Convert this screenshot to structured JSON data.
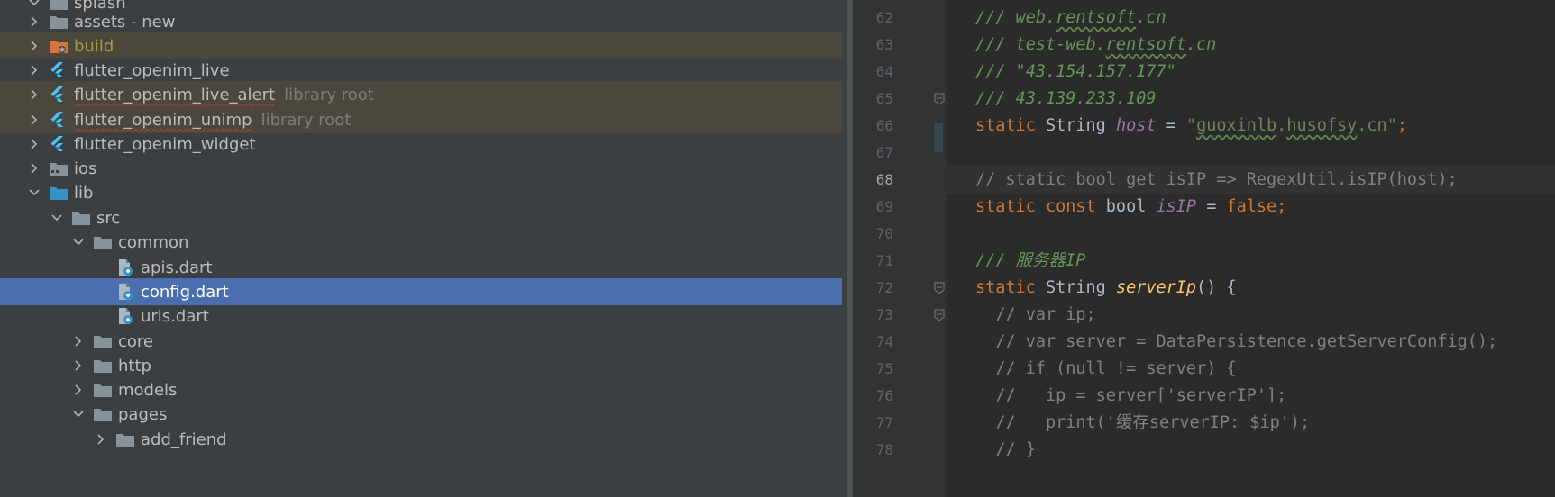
{
  "tree": {
    "items": [
      {
        "label": "splash",
        "suffix": "",
        "indent": 1,
        "expanded": true,
        "icon": "folder",
        "state": "normal"
      },
      {
        "label": "assets - new",
        "suffix": "",
        "indent": 1,
        "expanded": false,
        "icon": "folder",
        "state": "normal"
      },
      {
        "label": "build",
        "suffix": "",
        "indent": 1,
        "expanded": false,
        "icon": "folder-excluded",
        "state": "excluded"
      },
      {
        "label": "flutter_openim_live",
        "suffix": "",
        "indent": 1,
        "expanded": false,
        "icon": "flutter",
        "state": "normal"
      },
      {
        "label": "flutter_openim_live_alert",
        "suffix": "library root",
        "indent": 1,
        "expanded": false,
        "icon": "flutter",
        "state": "library"
      },
      {
        "label": "flutter_openim_unimp",
        "suffix": "library root",
        "indent": 1,
        "expanded": false,
        "icon": "flutter",
        "state": "library"
      },
      {
        "label": "flutter_openim_widget",
        "suffix": "",
        "indent": 1,
        "expanded": false,
        "icon": "flutter",
        "state": "normal"
      },
      {
        "label": "ios",
        "suffix": "",
        "indent": 1,
        "expanded": false,
        "icon": "folder-ios",
        "state": "normal"
      },
      {
        "label": "lib",
        "suffix": "",
        "indent": 1,
        "expanded": true,
        "icon": "folder-blue",
        "state": "normal"
      },
      {
        "label": "src",
        "suffix": "",
        "indent": 2,
        "expanded": true,
        "icon": "folder",
        "state": "normal"
      },
      {
        "label": "common",
        "suffix": "",
        "indent": 3,
        "expanded": true,
        "icon": "folder",
        "state": "normal"
      },
      {
        "label": "apis.dart",
        "suffix": "",
        "indent": 4,
        "expanded": null,
        "icon": "dart-file",
        "state": "normal"
      },
      {
        "label": "config.dart",
        "suffix": "",
        "indent": 4,
        "expanded": null,
        "icon": "dart-file",
        "state": "selected"
      },
      {
        "label": "urls.dart",
        "suffix": "",
        "indent": 4,
        "expanded": null,
        "icon": "dart-file",
        "state": "normal"
      },
      {
        "label": "core",
        "suffix": "",
        "indent": 3,
        "expanded": false,
        "icon": "folder",
        "state": "normal"
      },
      {
        "label": "http",
        "suffix": "",
        "indent": 3,
        "expanded": false,
        "icon": "folder",
        "state": "normal"
      },
      {
        "label": "models",
        "suffix": "",
        "indent": 3,
        "expanded": false,
        "icon": "folder",
        "state": "normal"
      },
      {
        "label": "pages",
        "suffix": "",
        "indent": 3,
        "expanded": true,
        "icon": "folder",
        "state": "normal"
      },
      {
        "label": "add_friend",
        "suffix": "",
        "indent": 4,
        "expanded": false,
        "icon": "folder",
        "state": "normal"
      }
    ]
  },
  "editor": {
    "current_line": 68,
    "lines": [
      {
        "n": "62",
        "tokens": [
          [
            "t-doc",
            "/// web."
          ],
          [
            "t-doc-u",
            "rentsoft"
          ],
          [
            "t-doc",
            ".cn"
          ]
        ]
      },
      {
        "n": "63",
        "tokens": [
          [
            "t-doc",
            "/// test-web."
          ],
          [
            "t-doc-u",
            "rentsoft"
          ],
          [
            "t-doc",
            ".cn"
          ]
        ]
      },
      {
        "n": "64",
        "tokens": [
          [
            "t-doc",
            "/// \"43.154.157.177\""
          ]
        ]
      },
      {
        "n": "65",
        "tokens": [
          [
            "t-doc",
            "/// 43.139.233.109"
          ]
        ]
      },
      {
        "n": "66",
        "tokens": [
          [
            "t-kw",
            "static "
          ],
          [
            "t-type",
            "String "
          ],
          [
            "t-field",
            "host"
          ],
          [
            "t-plain",
            " = "
          ],
          [
            "t-str",
            "\""
          ],
          [
            "t-str-u",
            "guoxinlb"
          ],
          [
            "t-str",
            "."
          ],
          [
            "t-str-u",
            "husofsy"
          ],
          [
            "t-str",
            ".cn\""
          ],
          [
            "t-kw",
            ";"
          ]
        ]
      },
      {
        "n": "67",
        "tokens": []
      },
      {
        "n": "68",
        "tokens": [
          [
            "t-cmt",
            "// static bool get isIP => RegexUtil.isIP(host);"
          ]
        ]
      },
      {
        "n": "69",
        "tokens": [
          [
            "t-kw",
            "static const "
          ],
          [
            "t-type",
            "bool "
          ],
          [
            "t-field",
            "isIP"
          ],
          [
            "t-plain",
            " = "
          ],
          [
            "t-kw",
            "false;"
          ]
        ]
      },
      {
        "n": "70",
        "tokens": []
      },
      {
        "n": "71",
        "tokens": [
          [
            "t-doc",
            "/// 服务器IP"
          ]
        ]
      },
      {
        "n": "72",
        "tokens": [
          [
            "t-kw",
            "static "
          ],
          [
            "t-type",
            "String "
          ],
          [
            "t-fn",
            "serverIp"
          ],
          [
            "t-plain",
            "() {"
          ]
        ]
      },
      {
        "n": "73",
        "tokens": [
          [
            "t-cmt",
            "  // var ip;"
          ]
        ]
      },
      {
        "n": "74",
        "tokens": [
          [
            "t-cmt",
            "  // var server = DataPersistence.getServerConfig();"
          ]
        ]
      },
      {
        "n": "75",
        "tokens": [
          [
            "t-cmt",
            "  // if (null != server) {"
          ]
        ]
      },
      {
        "n": "76",
        "tokens": [
          [
            "t-cmt",
            "  //   ip = server['serverIP'];"
          ]
        ]
      },
      {
        "n": "77",
        "tokens": [
          [
            "t-cmt",
            "  //   print('缓存serverIP: $ip');"
          ]
        ]
      },
      {
        "n": "78",
        "tokens": [
          [
            "t-cmt",
            "  // }"
          ]
        ]
      }
    ]
  },
  "colors": {
    "tree_bg": "#3c3f41",
    "selection": "#4b6eaf",
    "excluded_bg": "#4b473c",
    "editor_bg": "#2b2b2b",
    "keyword": "#cc7832",
    "doc_comment": "#629755",
    "field": "#9876aa"
  }
}
